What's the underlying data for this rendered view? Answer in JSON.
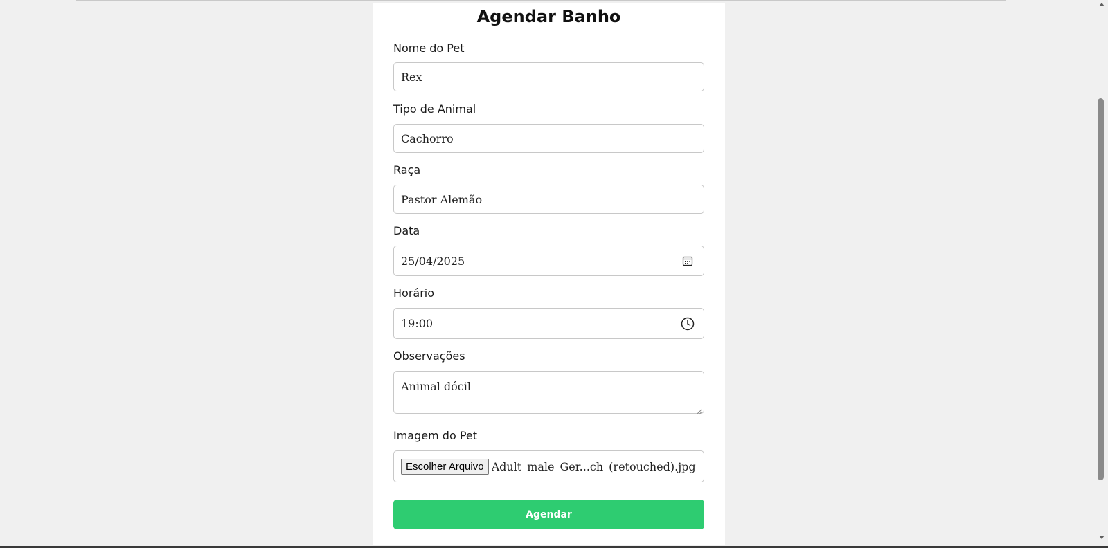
{
  "form": {
    "title": "Agendar Banho",
    "pet_name": {
      "label": "Nome do Pet",
      "value": "Rex"
    },
    "animal_type": {
      "label": "Tipo de Animal",
      "value": "Cachorro"
    },
    "breed": {
      "label": "Raça",
      "value": "Pastor Alemão"
    },
    "date": {
      "label": "Data",
      "value": "25/04/2025",
      "icon": "calendar-icon"
    },
    "time": {
      "label": "Horário",
      "value": "19:00",
      "icon": "clock-icon"
    },
    "notes": {
      "label": "Observações",
      "value": "Animal dócil"
    },
    "pet_image": {
      "label": "Imagem do Pet",
      "button_label": "Escolher Arquivo",
      "file_name": "Adult_male_Ger...ch_(retouched).jpg"
    },
    "submit_label": "Agendar"
  },
  "colors": {
    "background": "#f0f0f0",
    "card": "#ffffff",
    "accent": "#2ecc71",
    "border": "#c8c8c8"
  }
}
